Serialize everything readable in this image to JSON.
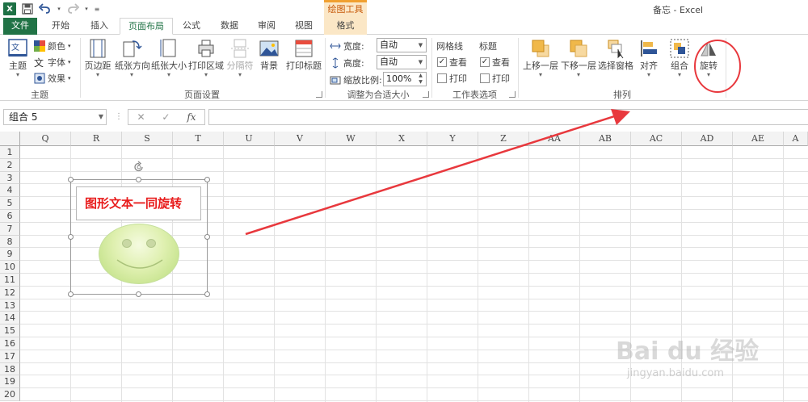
{
  "window": {
    "title": "备忘 - Excel",
    "undo_icon": "undo-icon",
    "redo_icon": "redo-icon",
    "save_icon": "save-icon"
  },
  "context_group": "绘图工具",
  "tabs": [
    {
      "label": "文件"
    },
    {
      "label": "开始"
    },
    {
      "label": "插入"
    },
    {
      "label": "页面布局"
    },
    {
      "label": "公式"
    },
    {
      "label": "数据"
    },
    {
      "label": "审阅"
    },
    {
      "label": "视图"
    },
    {
      "label": "格式"
    }
  ],
  "ribbon": {
    "theme_group": {
      "label": "主题",
      "theme_button": "主题",
      "colors": "颜色",
      "fonts": "字体",
      "effects": "效果"
    },
    "page_setup": {
      "label": "页面设置",
      "margins": "页边距",
      "orientation": "纸张方向",
      "size": "纸张大小",
      "print_area": "打印区域",
      "breaks": "分隔符",
      "background": "背景",
      "print_titles": "打印标题"
    },
    "scale": {
      "label": "调整为合适大小",
      "width_label": "宽度:",
      "width_value": "自动",
      "height_label": "高度:",
      "height_value": "自动",
      "scale_label": "缩放比例:",
      "scale_value": "100%"
    },
    "sheet_options": {
      "label": "工作表选项",
      "gridlines": "网格线",
      "headings": "标题",
      "view": "查看",
      "print": "打印",
      "gridlines_view_checked": true,
      "gridlines_print_checked": false,
      "headings_view_checked": true,
      "headings_print_checked": false
    },
    "arrange": {
      "label": "排列",
      "bring_forward": "上移一层",
      "send_backward": "下移一层",
      "selection_pane": "选择窗格",
      "align": "对齐",
      "group": "组合",
      "rotate": "旋转"
    }
  },
  "formula_bar": {
    "name_box": "组合 5",
    "cancel_icon": "✕",
    "enter_icon": "✓",
    "fx_label": "fx",
    "formula": ""
  },
  "columns": [
    "Q",
    "R",
    "S",
    "T",
    "U",
    "V",
    "W",
    "X",
    "Y",
    "Z",
    "AA",
    "AB",
    "AC",
    "AD",
    "AE",
    "A"
  ],
  "rows": [
    "1",
    "2",
    "3",
    "4",
    "5",
    "6",
    "7",
    "8",
    "9",
    "10",
    "11",
    "12",
    "13",
    "14",
    "15",
    "16",
    "17",
    "18",
    "19",
    "20"
  ],
  "shape": {
    "text": "图形文本一同旋转",
    "text_color": "#e81c1c"
  },
  "annotation": {
    "arrow_color": "#e8383d",
    "circle_color": "#e8383d"
  },
  "watermark": {
    "brand": "Bai du 经验",
    "url": "jingyan.baidu.com"
  }
}
